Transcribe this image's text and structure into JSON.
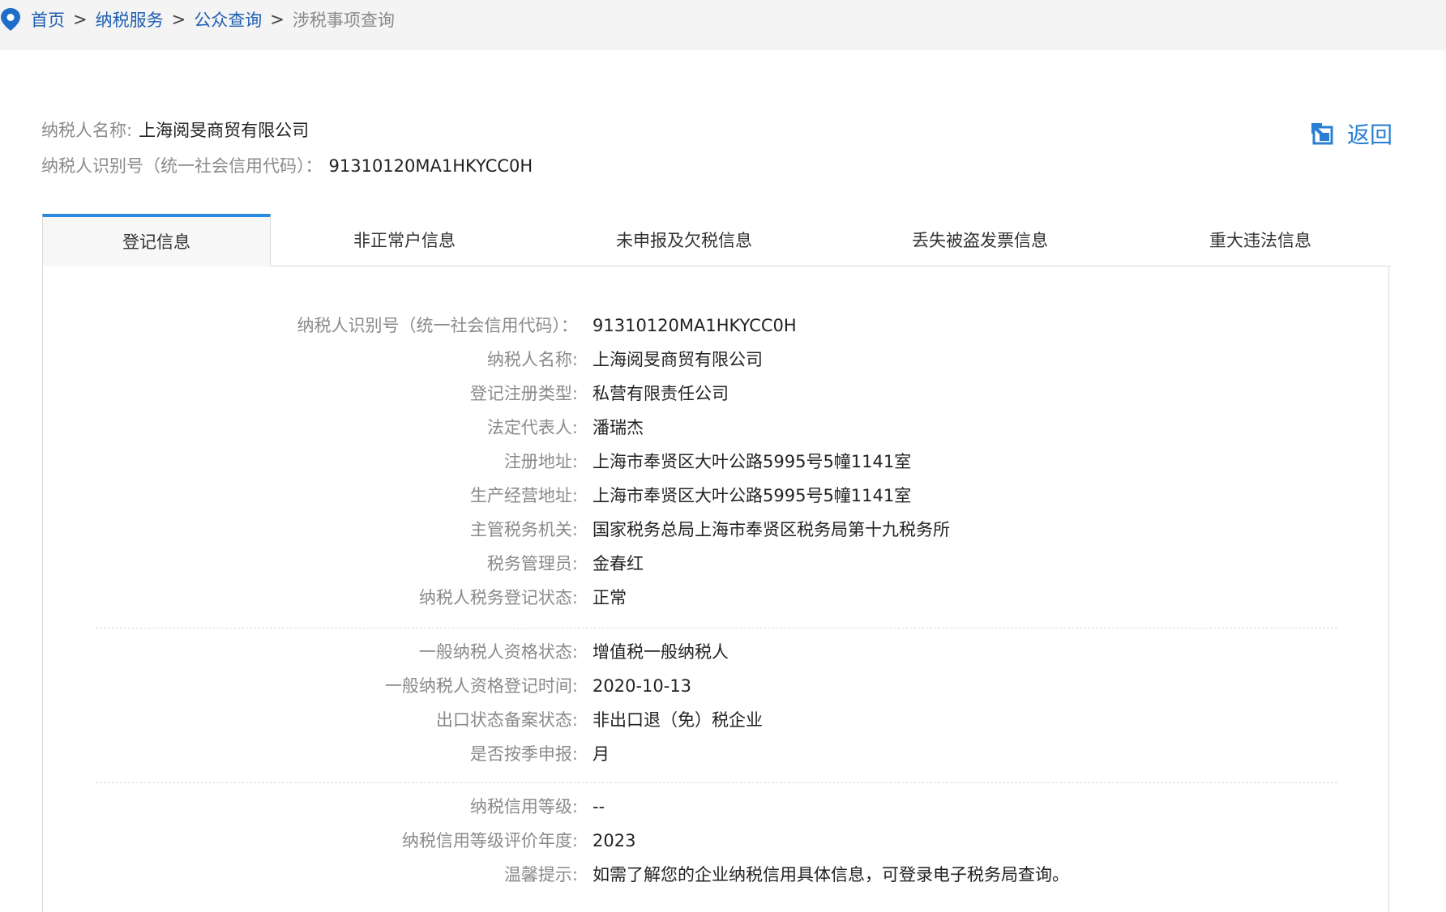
{
  "breadcrumb": {
    "items": [
      "首页",
      "纳税服务",
      "公众查询"
    ],
    "separator": ">",
    "current": "涉税事项查询"
  },
  "header": {
    "name_label": "纳税人名称:",
    "name_value": "上海阅旻商贸有限公司",
    "id_label": "纳税人识别号（统一社会信用代码）：",
    "id_value": "91310120MA1HKYCC0H",
    "back_label": "返回"
  },
  "tabs": [
    {
      "label": "登记信息",
      "active": true
    },
    {
      "label": "非正常户信息",
      "active": false
    },
    {
      "label": "未申报及欠税信息",
      "active": false
    },
    {
      "label": "丢失被盗发票信息",
      "active": false
    },
    {
      "label": "重大违法信息",
      "active": false
    }
  ],
  "registration": {
    "group1": [
      {
        "label": "纳税人识别号（统一社会信用代码）：",
        "value": "91310120MA1HKYCC0H"
      },
      {
        "label": "纳税人名称:",
        "value": "上海阅旻商贸有限公司"
      },
      {
        "label": "登记注册类型:",
        "value": "私营有限责任公司"
      },
      {
        "label": "法定代表人:",
        "value": "潘瑞杰"
      },
      {
        "label": "注册地址:",
        "value": "上海市奉贤区大叶公路5995号5幢1141室"
      },
      {
        "label": "生产经营地址:",
        "value": "上海市奉贤区大叶公路5995号5幢1141室"
      },
      {
        "label": "主管税务机关:",
        "value": "国家税务总局上海市奉贤区税务局第十九税务所"
      },
      {
        "label": "税务管理员:",
        "value": "金春红"
      },
      {
        "label": "纳税人税务登记状态:",
        "value": "正常"
      }
    ],
    "group2": [
      {
        "label": "一般纳税人资格状态:",
        "value": "增值税一般纳税人"
      },
      {
        "label": "一般纳税人资格登记时间:",
        "value": "2020-10-13"
      },
      {
        "label": "出口状态备案状态:",
        "value": "非出口退（免）税企业"
      },
      {
        "label": "是否按季申报:",
        "value": "月"
      }
    ],
    "group3": [
      {
        "label": "纳税信用等级:",
        "value": "--"
      },
      {
        "label": "纳税信用等级评价年度:",
        "value": "2023"
      },
      {
        "label": "温馨提示:",
        "value": "如需了解您的企业纳税信用具体信息，可登录电子税务局查询。"
      }
    ]
  },
  "colors": {
    "link": "#1f5fb1",
    "accent": "#2a8ae0",
    "label_gray": "#8a8a8a"
  }
}
